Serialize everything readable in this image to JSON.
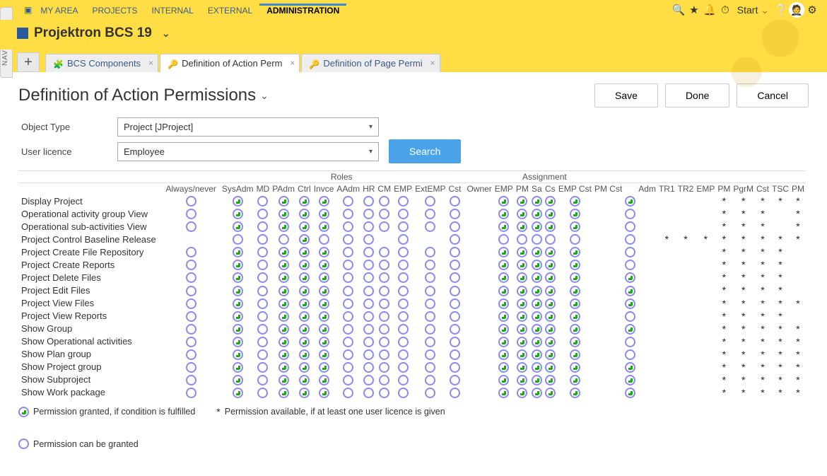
{
  "navigator_label": "NAVIGATOR",
  "top_nav": {
    "my_area_icon": "▣",
    "items": [
      "MY AREA",
      "PROJECTS",
      "INTERNAL",
      "EXTERNAL",
      "ADMINISTRATION"
    ],
    "active_index": 4,
    "start_label": "Start"
  },
  "app_title": "Projektron BCS 19",
  "tabs": [
    {
      "label": "BCS Components",
      "icon": "comp",
      "active": false,
      "closable": true
    },
    {
      "label": "Definition of Action Perm",
      "icon": "key",
      "active": true,
      "closable": true
    },
    {
      "label": "Definition of Page Permi",
      "icon": "key",
      "active": false,
      "closable": true
    }
  ],
  "page_title": "Definition of Action Permissions",
  "buttons": {
    "save": "Save",
    "done": "Done",
    "cancel": "Cancel",
    "search": "Search"
  },
  "filters": {
    "object_type_label": "Object Type",
    "object_type_value": "Project [JProject]",
    "user_licence_label": "User licence",
    "user_licence_value": "Employee"
  },
  "column_groups": {
    "roles": "Roles",
    "assignment": "Assignment"
  },
  "columns": {
    "always": "Always/never",
    "roles": [
      "SysAdm",
      "MD",
      "PAdm",
      "Ctrl",
      "Invce",
      "AAdm",
      "HR",
      "CM",
      "EMP",
      "ExtEMP",
      "Cst"
    ],
    "assignment": [
      "Owner",
      "EMP",
      "PM",
      "Sa",
      "Cs",
      "EMP Cst",
      "PM Cst"
    ],
    "extra": [
      "Adm",
      "TR1",
      "TR2",
      "EMP",
      "PM",
      "PgrM",
      "Cst",
      "TSC",
      "PM"
    ]
  },
  "rows": [
    {
      "label": "Display Project",
      "always": "e",
      "roles": [
        "p",
        "e",
        "p",
        "p",
        "p",
        "e",
        "e",
        "e",
        "e",
        "e",
        "e"
      ],
      "assign": [
        "",
        "p",
        "p",
        "p",
        "p",
        "p",
        "",
        "p"
      ],
      "extra": [
        "",
        "",
        "",
        "*",
        "*",
        "*",
        "*",
        "*",
        ""
      ]
    },
    {
      "label": "Operational activity group View",
      "always": "e",
      "roles": [
        "p",
        "e",
        "p",
        "p",
        "p",
        "e",
        "e",
        "e",
        "e",
        "e",
        "e"
      ],
      "assign": [
        "",
        "p",
        "p",
        "p",
        "p",
        "p",
        "",
        "e"
      ],
      "extra": [
        "",
        "",
        "",
        "*",
        "*",
        "*",
        "",
        "*",
        ""
      ]
    },
    {
      "label": "Operational sub-activities View",
      "always": "e",
      "roles": [
        "p",
        "e",
        "p",
        "p",
        "p",
        "e",
        "e",
        "e",
        "e",
        "e",
        "e"
      ],
      "assign": [
        "",
        "p",
        "p",
        "p",
        "p",
        "p",
        "",
        "e"
      ],
      "extra": [
        "",
        "",
        "",
        "*",
        "*",
        "*",
        "",
        "*",
        ""
      ]
    },
    {
      "label": "Project Control Baseline Release",
      "always": "",
      "roles": [
        "e",
        "e",
        "e",
        "p",
        "e",
        "e",
        "e",
        "",
        "e",
        "",
        "e"
      ],
      "assign": [
        "",
        "e",
        "e",
        "e",
        "e",
        "e",
        "",
        "e"
      ],
      "extra": [
        "*",
        "*",
        "*",
        "*",
        "*",
        "*",
        "*",
        "*",
        ""
      ]
    },
    {
      "label": "Project Create File Repository",
      "always": "e",
      "roles": [
        "p",
        "e",
        "p",
        "p",
        "p",
        "e",
        "e",
        "e",
        "e",
        "e",
        "e"
      ],
      "assign": [
        "",
        "p",
        "p",
        "p",
        "p",
        "p",
        "",
        "e"
      ],
      "extra": [
        "",
        "",
        "",
        "*",
        "*",
        "*",
        "*",
        "",
        ""
      ]
    },
    {
      "label": "Project Create Reports",
      "always": "e",
      "roles": [
        "p",
        "e",
        "p",
        "p",
        "p",
        "e",
        "e",
        "e",
        "e",
        "e",
        "e"
      ],
      "assign": [
        "",
        "p",
        "p",
        "p",
        "p",
        "p",
        "",
        "e"
      ],
      "extra": [
        "",
        "",
        "",
        "*",
        "*",
        "*",
        "*",
        "",
        ""
      ]
    },
    {
      "label": "Project Delete Files",
      "always": "e",
      "roles": [
        "p",
        "e",
        "p",
        "p",
        "p",
        "e",
        "e",
        "e",
        "e",
        "e",
        "e"
      ],
      "assign": [
        "",
        "p",
        "p",
        "p",
        "p",
        "p",
        "",
        "p"
      ],
      "extra": [
        "",
        "",
        "",
        "*",
        "*",
        "*",
        "*",
        "",
        ""
      ]
    },
    {
      "label": "Project Edit Files",
      "always": "e",
      "roles": [
        "p",
        "e",
        "p",
        "p",
        "p",
        "e",
        "e",
        "e",
        "e",
        "e",
        "e"
      ],
      "assign": [
        "",
        "p",
        "p",
        "p",
        "p",
        "p",
        "",
        "p"
      ],
      "extra": [
        "",
        "",
        "",
        "*",
        "*",
        "*",
        "*",
        "",
        ""
      ]
    },
    {
      "label": "Project View Files",
      "always": "e",
      "roles": [
        "p",
        "e",
        "p",
        "p",
        "p",
        "e",
        "e",
        "e",
        "e",
        "e",
        "e"
      ],
      "assign": [
        "",
        "p",
        "p",
        "p",
        "p",
        "p",
        "",
        "p"
      ],
      "extra": [
        "",
        "",
        "",
        "*",
        "*",
        "*",
        "*",
        "*",
        ""
      ]
    },
    {
      "label": "Project View Reports",
      "always": "e",
      "roles": [
        "p",
        "e",
        "p",
        "p",
        "p",
        "e",
        "e",
        "e",
        "e",
        "e",
        "e"
      ],
      "assign": [
        "",
        "p",
        "p",
        "p",
        "p",
        "p",
        "",
        "e"
      ],
      "extra": [
        "",
        "",
        "",
        "*",
        "*",
        "*",
        "*",
        "",
        ""
      ]
    },
    {
      "label": "Show Group",
      "always": "e",
      "roles": [
        "p",
        "e",
        "p",
        "p",
        "p",
        "e",
        "e",
        "e",
        "e",
        "e",
        "e"
      ],
      "assign": [
        "",
        "p",
        "p",
        "p",
        "p",
        "p",
        "",
        "p"
      ],
      "extra": [
        "",
        "",
        "",
        "*",
        "*",
        "*",
        "*",
        "*",
        ""
      ]
    },
    {
      "label": "Show Operational activities",
      "always": "e",
      "roles": [
        "p",
        "e",
        "p",
        "p",
        "p",
        "e",
        "e",
        "e",
        "e",
        "e",
        "e"
      ],
      "assign": [
        "",
        "p",
        "p",
        "p",
        "p",
        "p",
        "",
        "e"
      ],
      "extra": [
        "",
        "",
        "",
        "*",
        "*",
        "*",
        "*",
        "*",
        ""
      ]
    },
    {
      "label": "Show Plan group",
      "always": "e",
      "roles": [
        "p",
        "e",
        "p",
        "p",
        "p",
        "e",
        "e",
        "e",
        "e",
        "e",
        "e"
      ],
      "assign": [
        "",
        "p",
        "p",
        "p",
        "p",
        "p",
        "",
        "e"
      ],
      "extra": [
        "",
        "",
        "",
        "*",
        "*",
        "*",
        "*",
        "*",
        ""
      ]
    },
    {
      "label": "Show Project group",
      "always": "e",
      "roles": [
        "p",
        "e",
        "p",
        "p",
        "p",
        "e",
        "e",
        "e",
        "e",
        "e",
        "e"
      ],
      "assign": [
        "",
        "p",
        "p",
        "p",
        "p",
        "p",
        "",
        "p"
      ],
      "extra": [
        "",
        "",
        "",
        "*",
        "*",
        "*",
        "*",
        "*",
        ""
      ]
    },
    {
      "label": "Show Subproject",
      "always": "e",
      "roles": [
        "p",
        "e",
        "p",
        "p",
        "p",
        "e",
        "e",
        "e",
        "e",
        "e",
        "e"
      ],
      "assign": [
        "",
        "p",
        "p",
        "p",
        "p",
        "p",
        "",
        "p"
      ],
      "extra": [
        "",
        "",
        "",
        "*",
        "*",
        "*",
        "*",
        "*",
        ""
      ]
    },
    {
      "label": "Show Work package",
      "always": "e",
      "roles": [
        "p",
        "e",
        "p",
        "p",
        "p",
        "e",
        "e",
        "e",
        "e",
        "e",
        "e"
      ],
      "assign": [
        "",
        "p",
        "p",
        "p",
        "p",
        "p",
        "",
        "p"
      ],
      "extra": [
        "",
        "",
        "",
        "*",
        "*",
        "*",
        "*",
        "*",
        ""
      ]
    }
  ],
  "legend": {
    "granted": "Permission granted, if condition is fulfilled",
    "available": "Permission available, if at least one user licence is given",
    "can_grant": "Permission can be granted",
    "star": "*"
  }
}
